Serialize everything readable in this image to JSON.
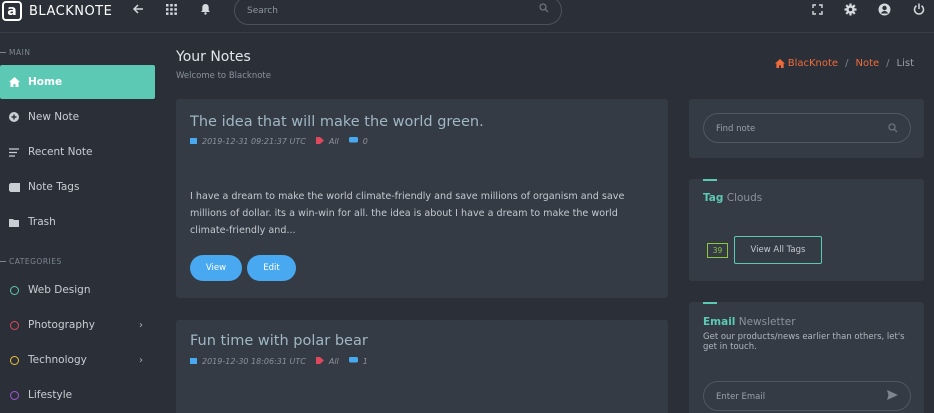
{
  "app": {
    "logo_letter": "a",
    "name": "BLACKNOTE"
  },
  "topbar": {
    "search_placeholder": "Search"
  },
  "sidebar": {
    "main_label": "MAIN",
    "main_items": [
      {
        "label": "Home",
        "icon": "home-icon"
      },
      {
        "label": "New Note",
        "icon": "plus-circle-icon"
      },
      {
        "label": "Recent Note",
        "icon": "list-icon"
      },
      {
        "label": "Note Tags",
        "icon": "tag-icon"
      },
      {
        "label": "Trash",
        "icon": "trash-icon"
      }
    ],
    "categories_label": "CATEGORIES",
    "categories": [
      {
        "label": "Web Design",
        "color": "#5cc9b4"
      },
      {
        "label": "Photography",
        "color": "#e0485d"
      },
      {
        "label": "Technology",
        "color": "#f0c03b"
      },
      {
        "label": "Lifestyle",
        "color": "#a05ad8"
      }
    ]
  },
  "header": {
    "title": "Your Notes",
    "subtitle": "Welcome to Blacknote",
    "breadcrumb": [
      "BlacKnote",
      "Note",
      "List"
    ]
  },
  "notes": [
    {
      "title": "The idea that will make the world green.",
      "date": "2019-12-31 09:21:37 UTC",
      "tag": "All",
      "comments": "0",
      "body": "I have a dream to make the world climate-friendly and save millions of organism and save millions of dollar. its a win-win for all. the idea is about I have a dream to make the world climate-friendly and...",
      "view_label": "View",
      "edit_label": "Edit"
    },
    {
      "title": "Fun time with polar bear",
      "date": "2019-12-30 18:06:31 UTC",
      "tag": "All",
      "comments": "1"
    }
  ],
  "widgets": {
    "find_placeholder": "Find note",
    "tag_clouds": {
      "highlight": "Tag",
      "rest": " Clouds",
      "count": "39",
      "button": "View All Tags"
    },
    "newsletter": {
      "highlight": "Email",
      "rest": " Newsletter",
      "description": "Get our products/news earlier than others, let's get in touch.",
      "email_placeholder": "Enter Email"
    }
  },
  "colors": {
    "accent": "#5cc9b4",
    "button": "#48a8f0",
    "breadcrumb": "#f06b3b",
    "background": "#2b3038",
    "card": "#353b44"
  }
}
